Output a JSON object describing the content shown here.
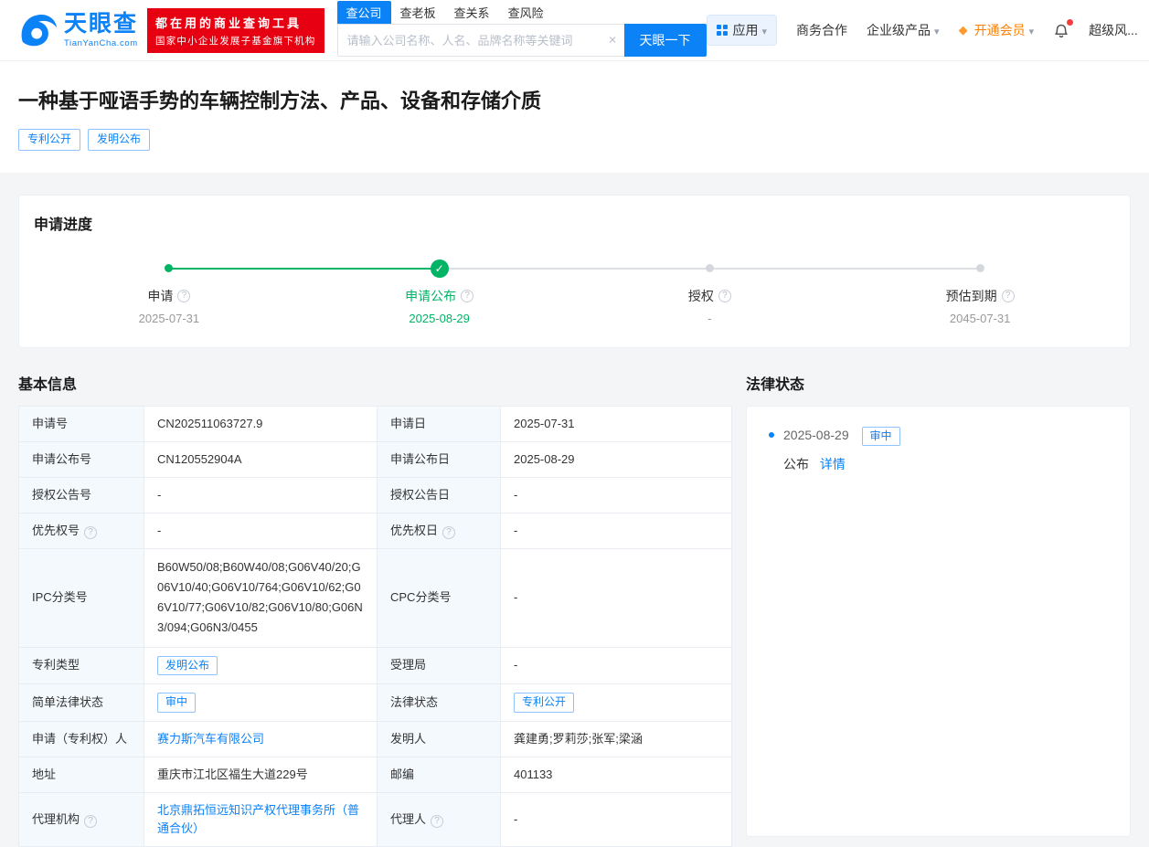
{
  "header": {
    "logo": {
      "name": "天眼查",
      "domain": "TianYanCha.com"
    },
    "badge": {
      "line1": "都在用的商业查询工具",
      "line2": "国家中小企业发展子基金旗下机构"
    },
    "search": {
      "tabs": [
        {
          "label": "查公司"
        },
        {
          "label": "查老板"
        },
        {
          "label": "查关系"
        },
        {
          "label": "查风险"
        }
      ],
      "placeholder": "请输入公司名称、人名、品牌名称等关键词",
      "clear_label": "×",
      "button": "天眼一下"
    },
    "nav": {
      "apps": "应用",
      "cooperation": "商务合作",
      "enterprise": "企业级产品",
      "vip": "开通会员",
      "risk": "超级风..."
    }
  },
  "patent": {
    "title": "一种基于哑语手势的车辆控制方法、产品、设备和存储介质",
    "tags": [
      {
        "label": "专利公开"
      },
      {
        "label": "发明公布"
      }
    ]
  },
  "progress": {
    "heading": "申请进度",
    "steps": [
      {
        "label": "申请",
        "date": "2025-07-31"
      },
      {
        "label": "申请公布",
        "date": "2025-08-29"
      },
      {
        "label": "授权",
        "date": "-"
      },
      {
        "label": "预估到期",
        "date": "2045-07-31"
      }
    ]
  },
  "basic_info": {
    "heading": "基本信息",
    "rows": [
      {
        "l1": "申请号",
        "v1": "CN202511063727.9",
        "l2": "申请日",
        "v2": "2025-07-31"
      },
      {
        "l1": "申请公布号",
        "v1": "CN120552904A",
        "l2": "申请公布日",
        "v2": "2025-08-29"
      },
      {
        "l1": "授权公告号",
        "v1": "-",
        "l2": "授权公告日",
        "v2": "-"
      },
      {
        "l1": "优先权号",
        "v1": "-",
        "l2": "优先权日",
        "v2": "-"
      },
      {
        "l1": "IPC分类号",
        "v1": "B60W50/08;B60W40/08;G06V40/20;G06V10/40;G06V10/764;G06V10/62;G06V10/77;G06V10/82;G06V10/80;G06N3/094;G06N3/0455",
        "l2": "CPC分类号",
        "v2": "-"
      },
      {
        "l1": "专利类型",
        "v1": "发明公布",
        "l2": "受理局",
        "v2": "-"
      },
      {
        "l1": "简单法律状态",
        "v1": "审中",
        "l2": "法律状态",
        "v2": "专利公开"
      },
      {
        "l1": "申请（专利权）人",
        "v1": "赛力斯汽车有限公司",
        "l2": "发明人",
        "v2": "龚建勇;罗莉莎;张军;梁涵"
      },
      {
        "l1": "地址",
        "v1": "重庆市江北区福生大道229号",
        "l2": "邮编",
        "v2": "401133"
      },
      {
        "l1": "代理机构",
        "v1": "北京鼎拓恒远知识产权代理事务所（普通合伙）",
        "l2": "代理人",
        "v2": "-"
      }
    ]
  },
  "legal_status": {
    "heading": "法律状态",
    "items": [
      {
        "date": "2025-08-29",
        "tag": "审中",
        "action": "公布",
        "link": "详情"
      }
    ]
  }
}
